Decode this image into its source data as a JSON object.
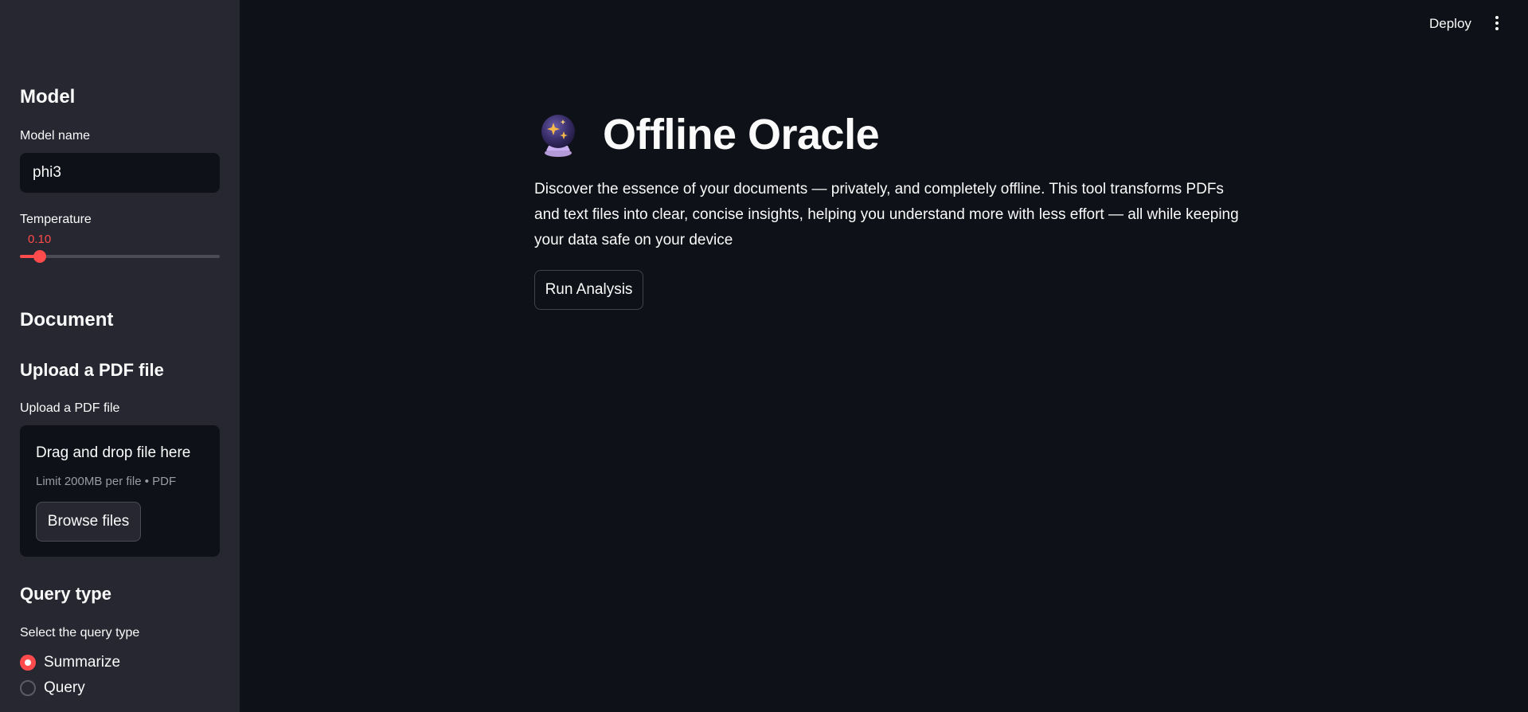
{
  "header": {
    "deploy_label": "Deploy",
    "menu_icon": "kebab-menu-icon"
  },
  "sidebar": {
    "model_heading": "Model",
    "model_name_label": "Model name",
    "model_name_value": "phi3",
    "temperature_label": "Temperature",
    "temperature_value": "0.10",
    "temperature_fraction": 0.1,
    "document_heading": "Document",
    "upload_heading": "Upload a PDF file",
    "upload_label": "Upload a PDF file",
    "dropzone_title": "Drag and drop file here",
    "dropzone_limit": "Limit 200MB per file • PDF",
    "browse_label": "Browse files",
    "query_type_heading": "Query type",
    "query_type_label": "Select the query type",
    "options": [
      {
        "label": "Summarize",
        "selected": true
      },
      {
        "label": "Query",
        "selected": false
      }
    ]
  },
  "main": {
    "title_icon": "crystal-ball-icon",
    "title": "Offline Oracle",
    "description": "Discover the essence of your documents — privately, and completely offline. This tool transforms PDFs and text files into clear, concise insights, helping you understand more with less effort — all while keeping your data safe on your device",
    "run_label": "Run Analysis"
  },
  "colors": {
    "accent": "#ff4b4b",
    "background": "#0e1117",
    "sidebar": "#262730"
  }
}
